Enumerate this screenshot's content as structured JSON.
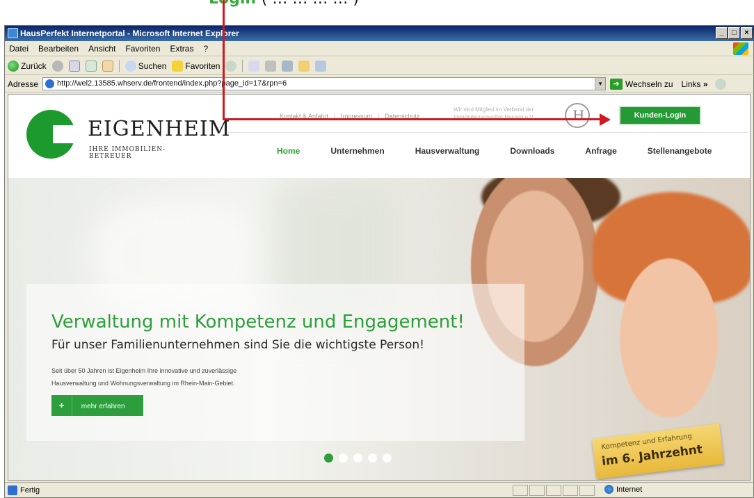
{
  "annotation": {
    "caption_green": "Login",
    "caption_rest": "( … … … … )"
  },
  "window": {
    "title": "HausPerfekt Internetportal - Microsoft Internet Explorer",
    "btn_min": "_",
    "btn_max": "□",
    "btn_close": "×"
  },
  "menu": [
    "Datei",
    "Bearbeiten",
    "Ansicht",
    "Favoriten",
    "Extras",
    "?"
  ],
  "toolbar": {
    "back": "Zurück",
    "search": "Suchen",
    "favorites": "Favoriten"
  },
  "address": {
    "label": "Adresse",
    "url": "http://wel2.13585.whserv.de/frontend/index.php?page_id=17&rpn=6",
    "go": "Wechseln zu",
    "links": "Links",
    "chevrons": "»"
  },
  "site": {
    "logo_word": "EIGENHEIM",
    "logo_tag": "IHRE IMMOBILIEN-BETREUER",
    "util_nav": [
      "Kontakt & Anfahrt",
      "Impressum",
      "Datenschutz"
    ],
    "util_sep": "|",
    "assoc_text": "Wir sind Mitglied im Verband der Immobilienverwalter Hessen e.V.",
    "login_button": "Kunden-Login",
    "nav": [
      "Home",
      "Unternehmen",
      "Hausverwaltung",
      "Downloads",
      "Anfrage",
      "Stellenangebote"
    ],
    "hero": {
      "title": "Verwaltung mit Kompetenz und Engagement!",
      "subtitle": "Für unser Familienunternehmen sind Sie die wichtigste Person!",
      "text_line1": "Seit über 50 Jahren ist Eigenheim Ihre innovative und zuverlässige",
      "text_line2": "Hausverwaltung und Wohnungsverwaltung im Rhein-Main-Gebiet.",
      "button_plus": "+",
      "button_label": "mehr erfahren",
      "active_slide": 1,
      "slide_count": 5
    },
    "badge": {
      "line1": "Kompetenz und Erfahrung",
      "line2": "im 6. Jahrzehnt"
    }
  },
  "status": {
    "text": "Fertig",
    "zone": "Internet"
  },
  "colors": {
    "brand_green": "#2d9e3c",
    "annotation_red": "#d0191f",
    "xp_title": "#0a246a"
  }
}
